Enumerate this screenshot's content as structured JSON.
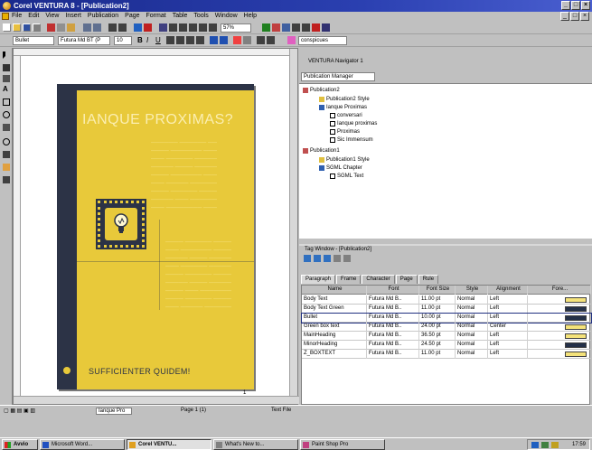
{
  "window": {
    "title": "Corel VENTURA 8 - [Publication2]"
  },
  "menu": [
    "File",
    "Edit",
    "View",
    "Insert",
    "Publication",
    "Page",
    "Format",
    "Table",
    "Tools",
    "Window",
    "Help"
  ],
  "toolbar": {
    "zoom": "57%",
    "doc_combo": "conspicues"
  },
  "formatbar": {
    "style": "Bullet",
    "font": "Futura Md BT (P",
    "size": "10"
  },
  "document": {
    "headline": "IANQUE PROXIMAS?",
    "footer": "SUFFICIENTER QUIDEM!",
    "page_number": "1"
  },
  "navigator": {
    "title": "VENTURA Navigator 1",
    "combo": "Publication Manager",
    "tree": [
      "Publication2",
      "Publication2 Style",
      "Ianque Proximas",
      "conversari",
      "Ianque proximas",
      "Proximas",
      "Sic Immensum",
      "Publication1",
      "Publication1 Style",
      "SGML Chapter",
      "SGML Text"
    ]
  },
  "tagwin": {
    "title": "Tag Window - [Publication2]",
    "tabs": [
      "Paragraph",
      "Frame",
      "Character",
      "Page",
      "Rule"
    ],
    "columns": [
      "Name",
      "Font",
      "Font Size",
      "Style",
      "Alignment",
      "Fore..."
    ],
    "rows": [
      {
        "name": "Body Text",
        "font": "Futura Md B..",
        "size": "11.00 pt",
        "style": "Normal",
        "align": "Left",
        "color": "#f4e27a"
      },
      {
        "name": "Body Text Green",
        "font": "Futura Md B..",
        "size": "11.00 pt",
        "style": "Normal",
        "align": "Left",
        "color": "#243048"
      },
      {
        "name": "Bullet",
        "font": "Futura Md B..",
        "size": "10.00 pt",
        "style": "Normal",
        "align": "Left",
        "color": "#243048"
      },
      {
        "name": "Green box text",
        "font": "Futura Md B..",
        "size": "24.00 pt",
        "style": "Normal",
        "align": "Center",
        "color": "#f4e27a"
      },
      {
        "name": "MainHeading",
        "font": "Futura Md B..",
        "size": "36.50 pt",
        "style": "Normal",
        "align": "Left",
        "color": "#f4e27a"
      },
      {
        "name": "MinorHeading",
        "font": "Futura Md B..",
        "size": "24.50 pt",
        "style": "Normal",
        "align": "Left",
        "color": "#243048"
      },
      {
        "name": "Z_BOXTEXT",
        "font": "Futura Md B..",
        "size": "11.00 pt",
        "style": "Normal",
        "align": "Left",
        "color": "#f4e27a"
      }
    ]
  },
  "status": {
    "combo": "Ianque Pro",
    "page": "Page 1 (1)",
    "mode": "Text File"
  },
  "taskbar": {
    "start": "Avvio",
    "tasks": [
      "Microsoft Word...",
      "Corel VENTU...",
      "What's New to...",
      "Paint Shop Pro"
    ],
    "clock": "17:59"
  },
  "colors": {
    "page_yellow": "#e8c93a",
    "page_navy": "#2c3346",
    "title_blue": "#1a2a8c"
  }
}
